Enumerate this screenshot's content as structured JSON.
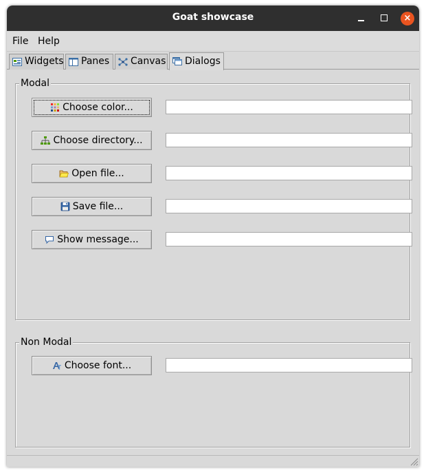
{
  "window": {
    "title": "Goat showcase",
    "minimize_glyph": "",
    "maximize_glyph": "",
    "close_glyph": "×"
  },
  "menubar": {
    "items": [
      {
        "label": "File"
      },
      {
        "label": "Help"
      }
    ]
  },
  "tabs": [
    {
      "label": "Widgets",
      "icon": "widgets-icon",
      "selected": false
    },
    {
      "label": "Panes",
      "icon": "panes-icon",
      "selected": false
    },
    {
      "label": "Canvas",
      "icon": "canvas-icon",
      "selected": false
    },
    {
      "label": "Dialogs",
      "icon": "dialogs-icon",
      "selected": true
    }
  ],
  "modal": {
    "legend": "Modal",
    "rows": [
      {
        "button": "Choose color...",
        "icon": "color-palette-icon",
        "value": "",
        "focused": true
      },
      {
        "button": "Choose directory...",
        "icon": "directory-tree-icon",
        "value": ""
      },
      {
        "button": "Open file...",
        "icon": "open-folder-icon",
        "value": ""
      },
      {
        "button": "Save file...",
        "icon": "floppy-disk-icon",
        "value": ""
      },
      {
        "button": "Show message...",
        "icon": "speech-bubble-icon",
        "value": ""
      }
    ]
  },
  "non_modal": {
    "legend": "Non Modal",
    "rows": [
      {
        "button": "Choose font...",
        "icon": "font-icon",
        "value": ""
      }
    ]
  },
  "colors": {
    "titlebar": "#2f2f2f",
    "close_button": "#e95420",
    "window_bg": "#d9d9d9"
  }
}
